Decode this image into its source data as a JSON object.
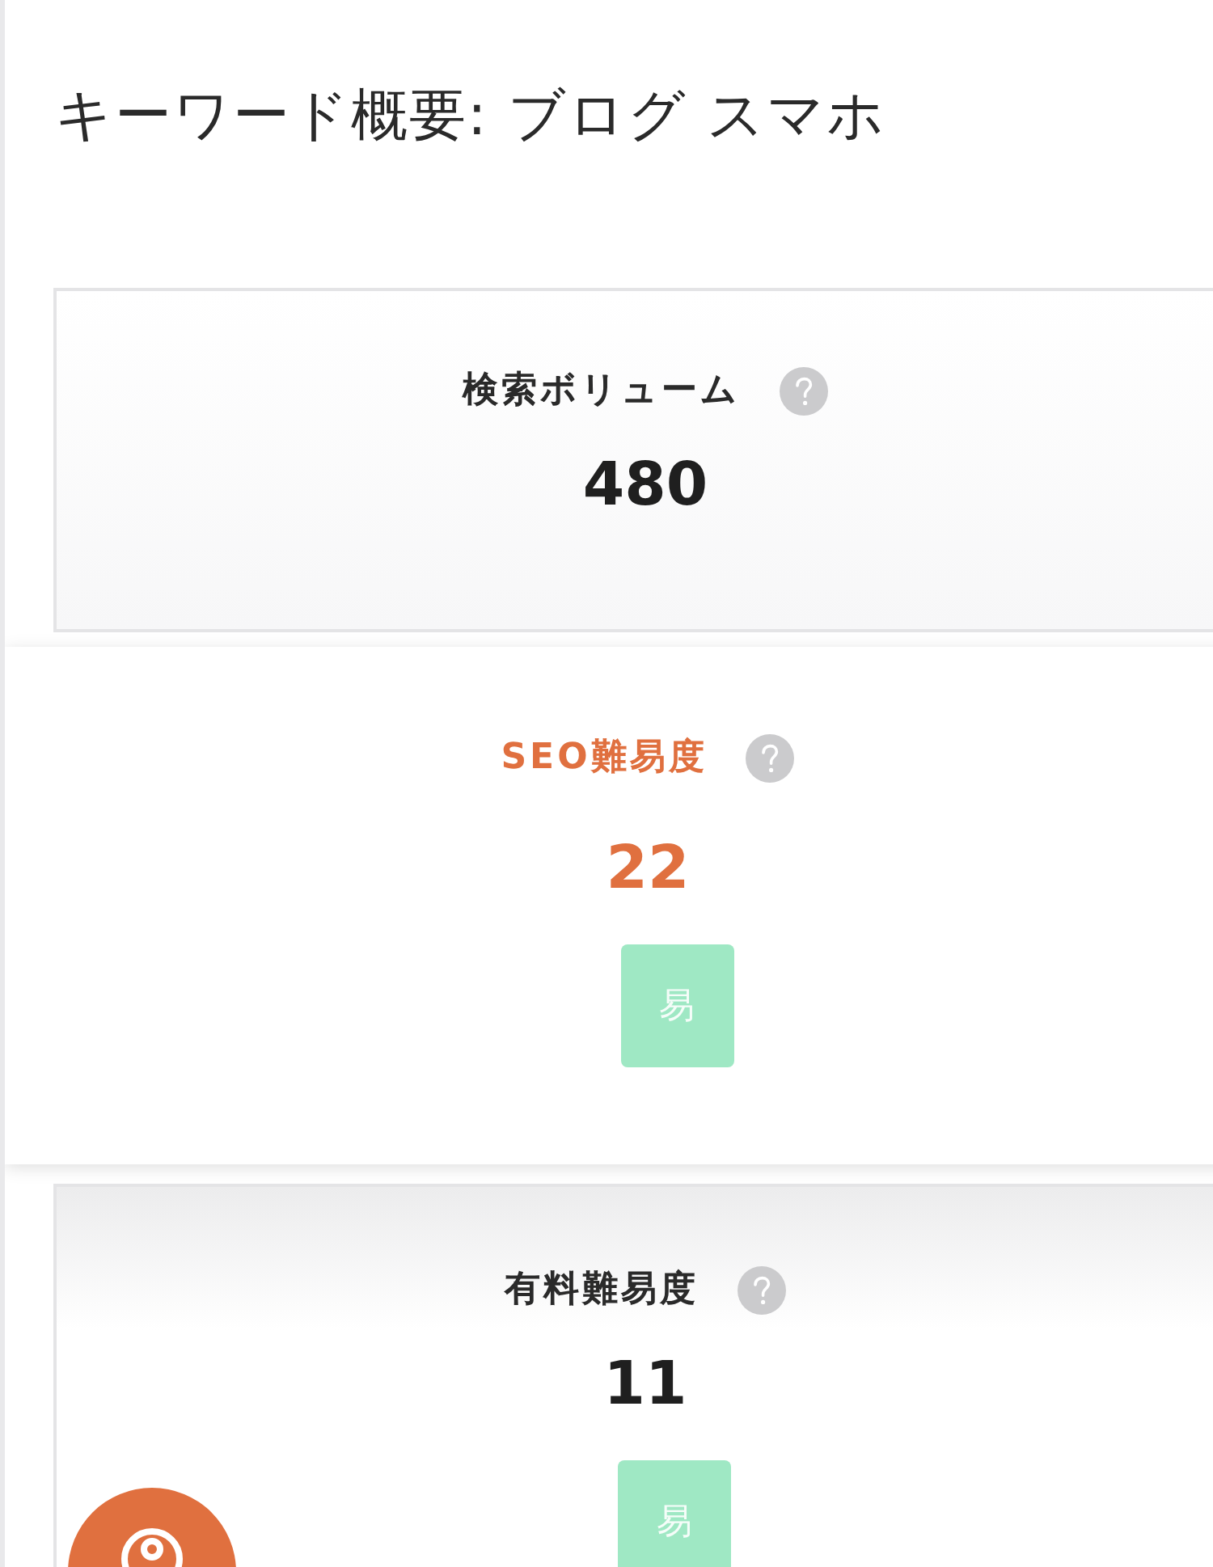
{
  "page": {
    "title": "キーワード概要: ブログ スマホ"
  },
  "metrics": [
    {
      "label": "検索ボリューム",
      "value": "480",
      "selected": false
    },
    {
      "label": "SEO難易度",
      "value": "22",
      "selected": true,
      "badge": "易"
    },
    {
      "label": "有料難易度",
      "value": "11",
      "selected": false,
      "badge": "易"
    }
  ]
}
